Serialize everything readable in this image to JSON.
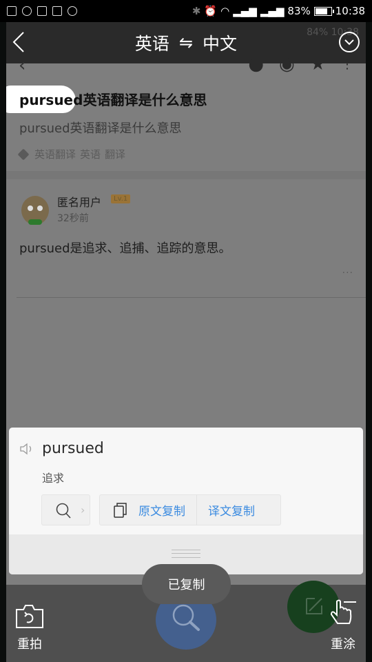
{
  "status_bar": {
    "left_icons": [
      "calendar-icon",
      "shield-icon",
      "image-icon",
      "sim-icon",
      "more-circle-icon"
    ],
    "right_icons": [
      "bluetooth-icon",
      "alarm-icon",
      "wifi-icon",
      "signal-icon",
      "signal-icon"
    ],
    "battery_percent": "83%",
    "battery_level": 0.83,
    "time": "10:38"
  },
  "captured_page": {
    "ghost_status_text": "84% 10:38",
    "action_icons": [
      "wechat-icon",
      "moments-icon",
      "qzone-star-icon",
      "more-vert-icon"
    ],
    "question_title": "pursued英语翻译是什么意思",
    "question_subtitle": "pursued英语翻译是什么意思",
    "tags": [
      "英语翻译",
      "英语",
      "翻译"
    ],
    "answer": {
      "user_name": "匿名用户",
      "level_badge": "Lv.1",
      "time_ago": "32秒前",
      "text": "pursued是追求、追捕、追踪的意思。",
      "more": "···"
    }
  },
  "top_bar": {
    "source_lang": "英语",
    "swap_symbol": "⇋",
    "target_lang": "中文"
  },
  "translation_card": {
    "word": "pursued",
    "meaning": "追求",
    "copy_original_label": "原文复制",
    "copy_translation_label": "译文复制",
    "chevron": "›"
  },
  "toast": "已复制",
  "bottom_bar": {
    "retake_label": "重拍",
    "repaint_label": "重涂"
  },
  "colors": {
    "link_blue": "#3b8be0",
    "search_circle": "#44608e",
    "repaint_circle": "#17401e"
  }
}
